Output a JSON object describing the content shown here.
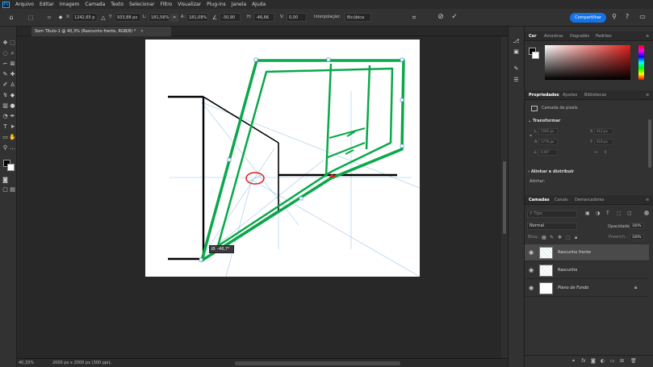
{
  "app": {
    "logo": "Ps",
    "menu": [
      "Arquivo",
      "Editar",
      "Imagem",
      "Camada",
      "Texto",
      "Selecionar",
      "Filtro",
      "Visualizar",
      "Plug-ins",
      "Janela",
      "Ajuda"
    ]
  },
  "options": {
    "x_label": "X:",
    "x_value": "1242,65 p",
    "y_label": "Y:",
    "y_value": "933,88 px",
    "w_label": "L:",
    "w_value": "181,56%",
    "h_label": "A:",
    "h_value": "181,08%",
    "angle_value": "-30,90",
    "hskew_label": "H:",
    "hskew_value": "-46,66",
    "vskew_label": "V:",
    "vskew_value": "0,00",
    "interp_label": "Interpolação:",
    "interp_value": "Bicúbica",
    "share_label": "Compartilhar"
  },
  "document": {
    "tab_title": "Sem Título-1 @ 40,3% (Rascunho frente, RGB/8) *",
    "tooltip": "Ø: -46,7°"
  },
  "status": {
    "zoom": "40,33%",
    "doc_info": "2000 px x 2000 px (300 ppi)"
  },
  "panels": {
    "color_tabs": [
      "Cor",
      "Amostras",
      "Degradês",
      "Padrões"
    ],
    "prop_tabs": [
      "Propriedades",
      "Ajustes",
      "Bibliotecas"
    ],
    "pixel_layer_label": "Camada de pixels",
    "transform_title": "Transformar",
    "transform_fields": {
      "w": "1565 px",
      "x": "412 px",
      "h": "1776 px",
      "y": "418 px",
      "angle": "0,00°"
    },
    "align_title": "Alinhar e distribuir",
    "align_label": "Alinhar:",
    "layer_tabs": [
      "Camadas",
      "Canais",
      "Demarcadores"
    ],
    "kind_placeholder": "Tipo",
    "blend_mode": "Normal",
    "opacity_label": "Opacidade:",
    "opacity_value": "100%",
    "lock_label": "Bloq.:",
    "fill_label": "Preench.:",
    "fill_value": "100%",
    "layers": [
      {
        "name": "Rascunho frente",
        "selected": true,
        "italic": false
      },
      {
        "name": "Rascunho",
        "selected": false,
        "italic": false
      },
      {
        "name": "Plano de Fundo",
        "selected": false,
        "italic": true
      }
    ]
  },
  "colors": {
    "accent": "#1473e6",
    "sketch_green": "#0aa84a",
    "sketch_black": "#000000",
    "guide_blue": "#9fc6e8",
    "red": "#e0201b"
  }
}
